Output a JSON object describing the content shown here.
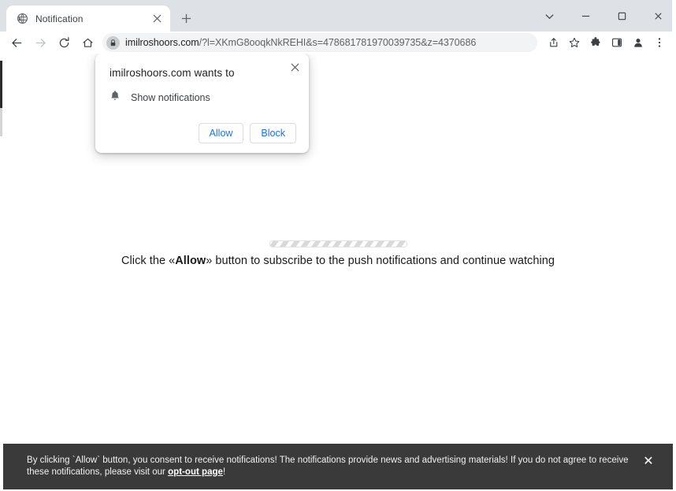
{
  "window": {
    "controls": [
      {
        "name": "tab-search",
        "glyph": "chevron-down-icon"
      },
      {
        "name": "minimize",
        "glyph": "minimize-icon"
      },
      {
        "name": "maximize",
        "glyph": "maximize-icon"
      },
      {
        "name": "close",
        "glyph": "close-icon"
      }
    ]
  },
  "tabstrip": {
    "tab": {
      "title": "Notification",
      "favicon": "globe-icon",
      "close_label": "×"
    },
    "new_tab_label": "+"
  },
  "toolbar": {
    "back_icon": "arrow-left-icon",
    "forward_icon": "arrow-right-icon",
    "reload_icon": "reload-icon",
    "home_icon": "home-icon",
    "lock_icon": "lock-icon",
    "url_host": "imilroshoors.com",
    "url_rest": "/?l=XKmG8ooqkNkREHI&s=478681781970039735&z=4370686",
    "url_full": "imilroshoors.com/?l=XKmG8ooqkNkREHI&s=478681781970039735&z=4370686",
    "share_icon": "share-icon",
    "bookmark_icon": "star-icon",
    "extensions_icon": "puzzle-icon",
    "sidepanel_icon": "side-panel-icon",
    "profile_icon": "profile-avatar-icon",
    "menu_icon": "three-dot-menu-icon"
  },
  "permission_dialog": {
    "title": "imilroshoors.com wants to",
    "permission_icon": "bell-icon",
    "permission_label": "Show notifications",
    "allow_label": "Allow",
    "block_label": "Block",
    "close_label": "×"
  },
  "page": {
    "text_before": "Click the «",
    "text_bold": "Allow",
    "text_after": "» button to subscribe to the push notifications and continue watching",
    "progress_label": "loading-progress-bar"
  },
  "consent_banner": {
    "text_part1": "By clicking `Allow` button, you consent to receive notifications! The notifications provide news and advertising materials! If you do not agree to receive these notifications, please visit our ",
    "link_label": "opt-out page",
    "text_part2": "!",
    "close_label": "✕"
  },
  "colors": {
    "tabstrip_bg": "#dee1e6",
    "omnibox_bg": "#f1f3f4",
    "accent_blue": "#1a73e8",
    "banner_bg": "#3a3a3a",
    "page_bg": "#ffffff"
  }
}
